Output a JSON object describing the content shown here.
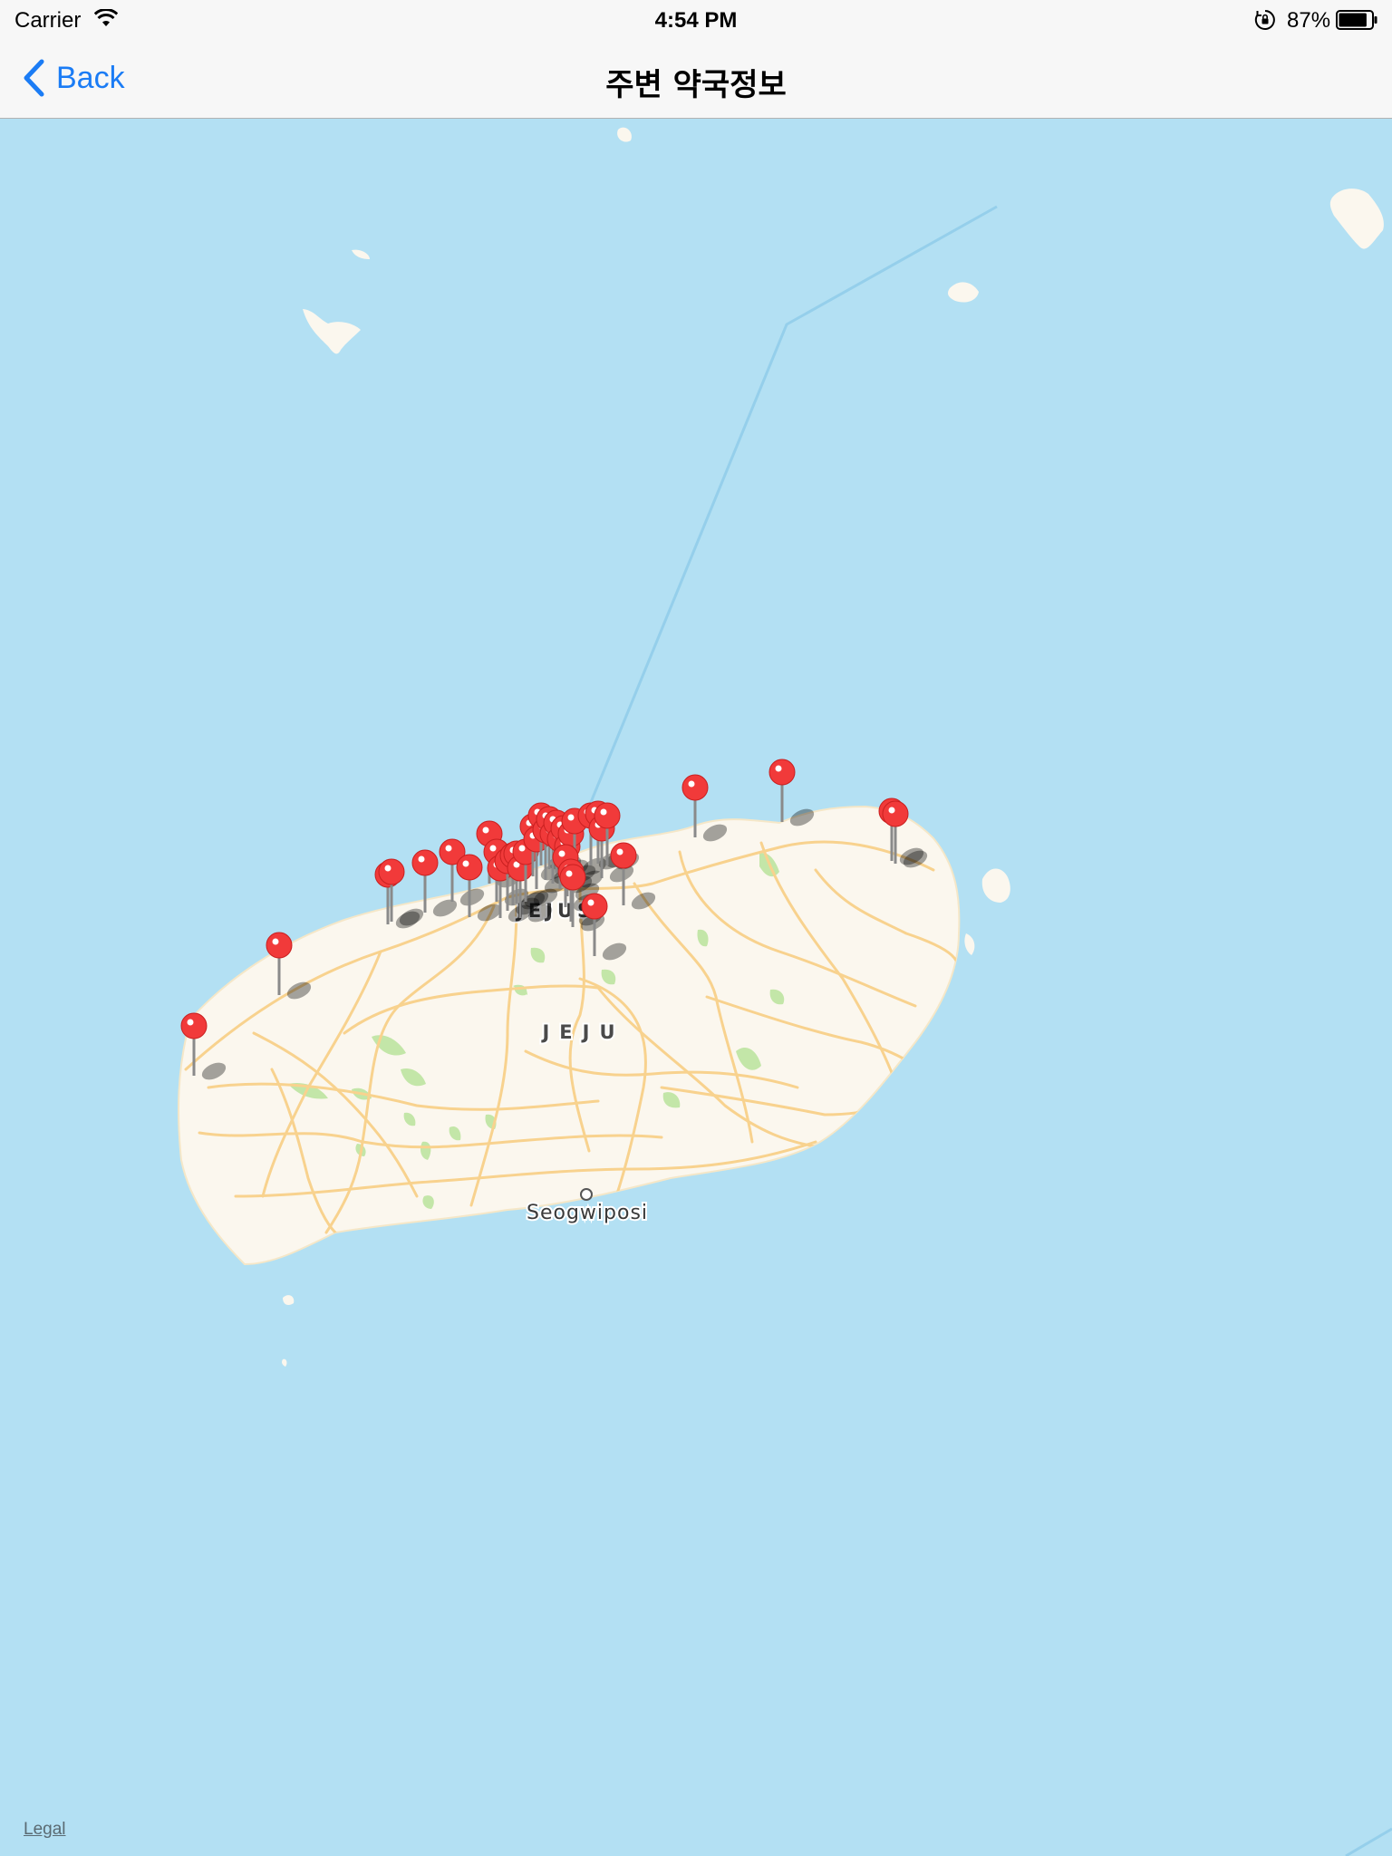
{
  "status_bar": {
    "carrier": "Carrier",
    "time": "4:54 PM",
    "battery_percent": "87%",
    "battery_level": 0.87,
    "icons": [
      "wifi-icon",
      "orientation-lock-icon",
      "battery-icon"
    ]
  },
  "nav_bar": {
    "back_label": "Back",
    "title": "주변 약국정보",
    "back_icon": "chevron-left-icon",
    "accent_color": "#1b7cf5"
  },
  "map": {
    "labels": {
      "city": "JEJUSI",
      "region": "JEJU",
      "town": "Seogwiposi"
    },
    "legal_link": "Legal",
    "pin_color": "#f13a3a",
    "water_color": "#b3e0f3",
    "land_color": "#fbf7ee",
    "road_color": "#f8d28e",
    "park_color": "#c3e6a8",
    "pin_icon": "map-pin-icon"
  }
}
